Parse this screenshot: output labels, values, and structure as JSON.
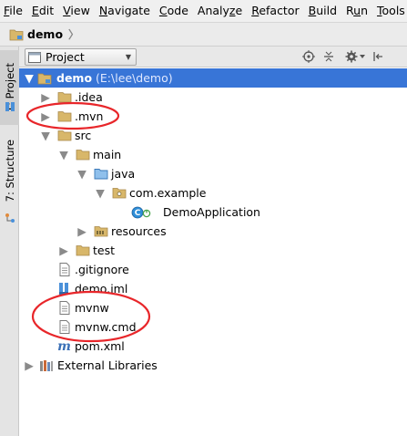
{
  "menu": [
    {
      "u": "F",
      "rest": "ile"
    },
    {
      "u": "E",
      "rest": "dit"
    },
    {
      "u": "V",
      "rest": "iew"
    },
    {
      "u": "N",
      "rest": "avigate"
    },
    {
      "u": "C",
      "rest": "ode"
    },
    {
      "pre": "Analy",
      "u": "z",
      "rest": "e"
    },
    {
      "u": "R",
      "rest": "efactor"
    },
    {
      "u": "B",
      "rest": "uild"
    },
    {
      "pre": "R",
      "u": "u",
      "rest": "n"
    },
    {
      "u": "T",
      "rest": "ools"
    }
  ],
  "breadcrumb": {
    "project": "demo"
  },
  "side_tabs": {
    "project": "1: Project",
    "structure": "7: Structure"
  },
  "panel": {
    "view_mode": "Project"
  },
  "tree": [
    {
      "id": "demo",
      "label": "demo",
      "suffix": " (E:\\lee\\demo)",
      "icon": "module-folder",
      "expanded": true,
      "selected": true
    },
    {
      "id": "idea",
      "label": ".idea",
      "icon": "folder",
      "expanded": false
    },
    {
      "id": "mvn",
      "label": ".mvn",
      "icon": "folder",
      "expanded": false
    },
    {
      "id": "src",
      "label": "src",
      "icon": "folder",
      "expanded": true
    },
    {
      "id": "main",
      "label": "main",
      "icon": "folder",
      "expanded": true
    },
    {
      "id": "java",
      "label": "java",
      "icon": "source-folder",
      "expanded": true
    },
    {
      "id": "com-example",
      "label": "com.example",
      "icon": "package",
      "expanded": true
    },
    {
      "id": "demo-application",
      "label": "DemoApplication",
      "icon": "spring-boot-class"
    },
    {
      "id": "resources",
      "label": "resources",
      "icon": "resources-folder",
      "expanded": false
    },
    {
      "id": "test",
      "label": "test",
      "icon": "folder",
      "expanded": false
    },
    {
      "id": "gitignore",
      "label": ".gitignore",
      "icon": "text-file"
    },
    {
      "id": "demo-iml",
      "label": "demo.iml",
      "icon": "iml-file"
    },
    {
      "id": "mvnw",
      "label": "mvnw",
      "icon": "text-file"
    },
    {
      "id": "mvnw-cmd",
      "label": "mvnw.cmd",
      "icon": "text-file"
    },
    {
      "id": "pom-xml",
      "label": "pom.xml",
      "icon": "maven-file"
    },
    {
      "id": "external-libraries",
      "label": "External Libraries",
      "icon": "libraries",
      "expanded": false
    }
  ],
  "colors": {
    "selection": "#3875d7",
    "folder": "#d8b76a",
    "source_folder": "#4a90d9",
    "annotation": "#e8262a"
  }
}
